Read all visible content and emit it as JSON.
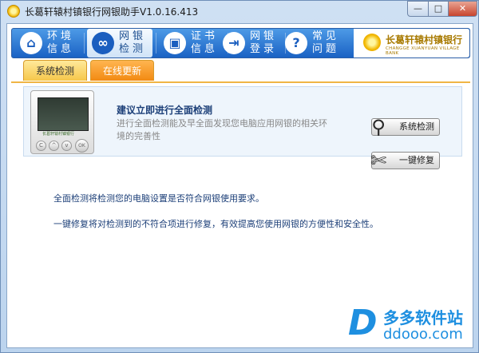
{
  "window": {
    "title": "长葛轩辕村镇银行网银助手V1.0.16.413",
    "controls": {
      "minimize": "—",
      "maximize": "□",
      "close": "✕"
    }
  },
  "nav": {
    "items": [
      {
        "label": "环境信息",
        "icon": "home-icon",
        "active": false
      },
      {
        "label": "网银检测",
        "icon": "stethoscope-icon",
        "active": true
      },
      {
        "label": "证书信息",
        "icon": "certificate-icon",
        "active": false
      },
      {
        "label": "网银登录",
        "icon": "login-icon",
        "active": false
      },
      {
        "label": "常见问题",
        "icon": "question-icon",
        "active": false
      }
    ],
    "logo": {
      "name": "长葛轩辕村镇银行",
      "english": "CHANGGE XUANYUAN VILLAGE BANK"
    }
  },
  "tabs": [
    {
      "label": "系统检测",
      "active": true
    },
    {
      "label": "在线更新",
      "active": false
    }
  ],
  "panel": {
    "device_label": "长葛轩辕村镇银行",
    "device_buttons": [
      "C",
      "^",
      "v",
      "OK"
    ],
    "headline": "建议立即进行全面检测",
    "description": "进行全面检测能及早全面发现您电脑应用网银的相关环境的完善性"
  },
  "actions": {
    "check": "系统检测",
    "repair": "一键修复"
  },
  "info": {
    "line1": "全面检测将检测您的电脑设置是否符合网银使用要求。",
    "line2": "一键修复将对检测到的不符合项进行修复，有效提高您使用网银的方便性和安全性。"
  },
  "watermark": {
    "brand": "多多软件站",
    "url": "ddooo.com"
  },
  "colors": {
    "nav_bar": "#1a62c4",
    "tab_active": "#f6c74b",
    "tab_inactive": "#f28a12",
    "headline": "#1c3f78",
    "watermark": "#1e8fe0"
  }
}
